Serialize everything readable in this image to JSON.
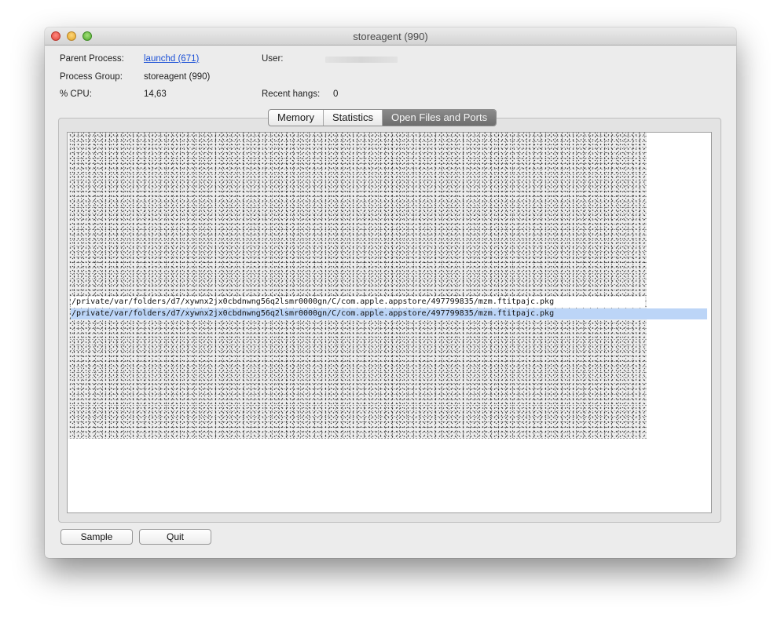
{
  "window": {
    "title": "storeagent (990)"
  },
  "info": {
    "parent_process_label": "Parent Process:",
    "parent_process_value": "launchd (671)",
    "process_group_label": "Process Group:",
    "process_group_value": "storeagent (990)",
    "cpu_label": "% CPU:",
    "cpu_value": "14,63",
    "user_label": "User:",
    "recent_hangs_label": "Recent hangs:",
    "recent_hangs_value": "0"
  },
  "tabs": [
    {
      "label": "Memory",
      "active": false
    },
    {
      "label": "Statistics",
      "active": false
    },
    {
      "label": "Open Files and Ports",
      "active": true
    }
  ],
  "open_files": [
    {
      "path": "/private/var/folders/d7/xywnx2jx0cbdnwng56q2lsmr0000gn/C/com.apple.appstore/497799835/mzm.ftitpajc.pkg",
      "selected": false
    },
    {
      "path": "/private/var/folders/d7/xywnx2jx0cbdnwng56q2lsmr0000gn/C/com.apple.appstore/497799835/mzm.ftitpajc.pkg",
      "selected": true
    }
  ],
  "buttons": {
    "sample": "Sample",
    "quit": "Quit"
  },
  "colors": {
    "selection": "#bcd5f7",
    "link": "#1a4fd6"
  },
  "icons": [
    "close-icon",
    "minimize-icon",
    "zoom-icon"
  ]
}
